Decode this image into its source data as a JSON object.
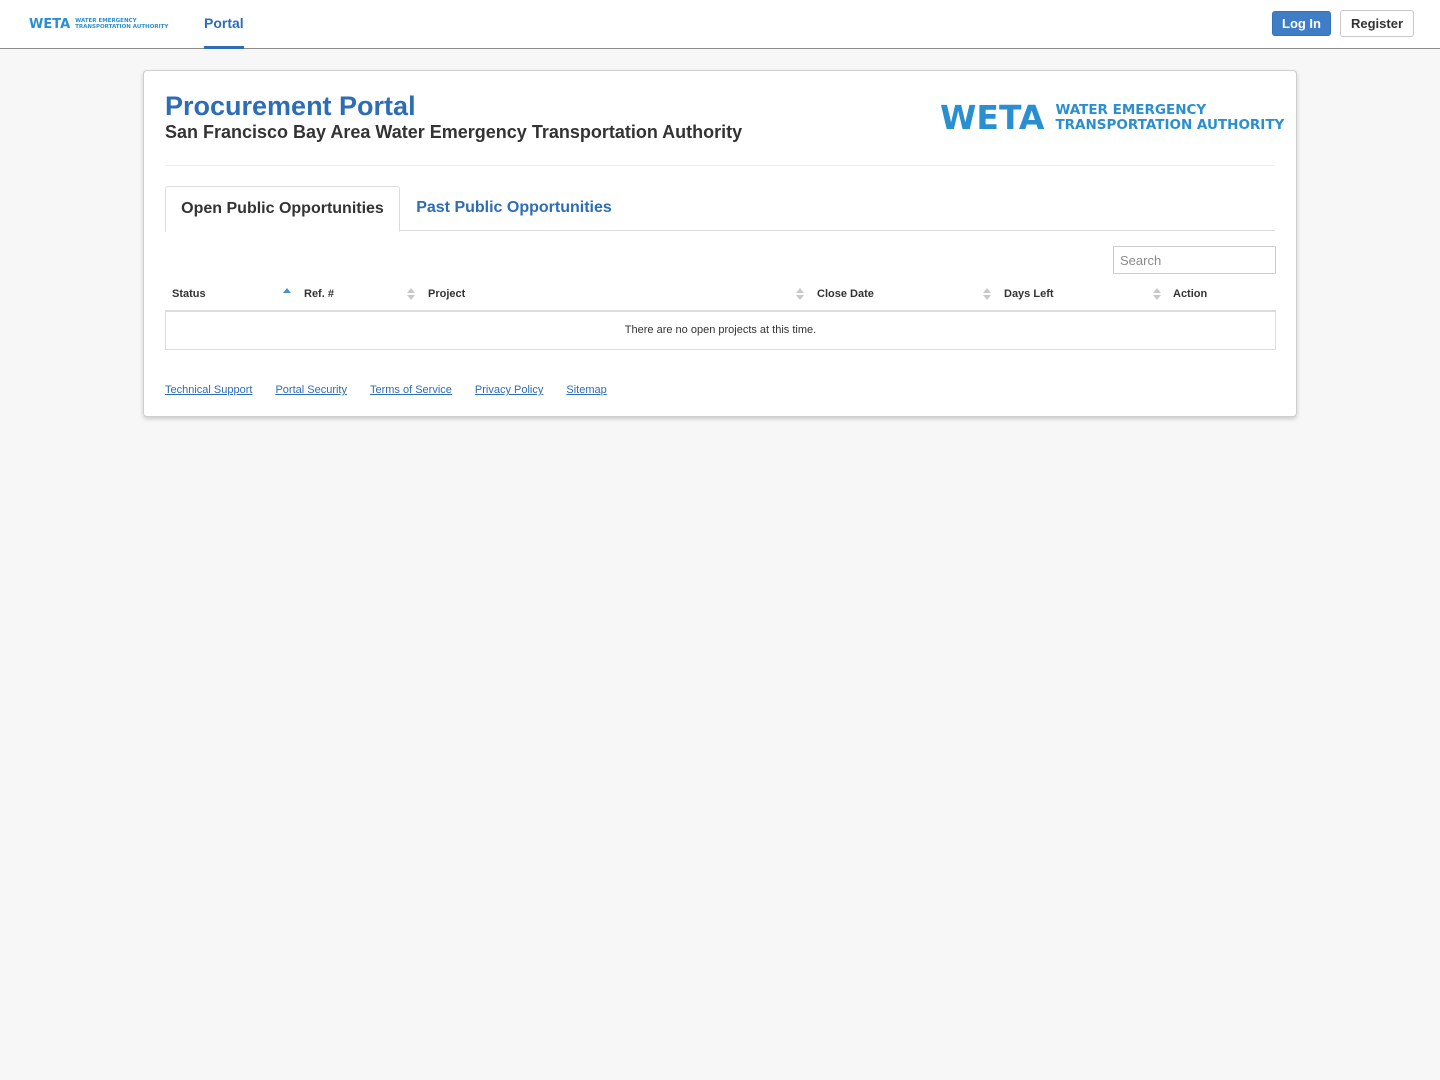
{
  "topnav": {
    "logo": {
      "mark": "WETA",
      "line1": "Water Emergency",
      "line2": "Transportation Authority"
    },
    "portal_tab": "Portal",
    "login_label": "Log In",
    "register_label": "Register"
  },
  "header": {
    "title": "Procurement Portal",
    "subtitle": "San Francisco Bay Area Water Emergency Transportation Authority",
    "logo": {
      "mark": "WETA",
      "line1": "Water Emergency",
      "line2": "Transportation Authority"
    }
  },
  "tabs": [
    {
      "label": "Open Public Opportunities",
      "active": true
    },
    {
      "label": "Past Public Opportunities",
      "active": false
    }
  ],
  "search": {
    "placeholder": "Search",
    "value": ""
  },
  "table": {
    "columns": [
      {
        "label": "Status",
        "sort": "ascending"
      },
      {
        "label": "Ref. #",
        "sort": "none"
      },
      {
        "label": "Project",
        "sort": "none"
      },
      {
        "label": "Close Date",
        "sort": "none"
      },
      {
        "label": "Days Left",
        "sort": "none"
      },
      {
        "label": "Action",
        "sort": "none"
      }
    ],
    "rows": [],
    "empty_message": "There are no open projects at this time."
  },
  "footer": {
    "links": [
      "Technical Support",
      "Portal Security",
      "Terms of Service",
      "Privacy Policy",
      "Sitemap"
    ]
  },
  "colors": {
    "brand_blue": "#2d6db5",
    "logo_blue": "#2a8fd0",
    "login_button": "#3f7ec6",
    "page_background": "#f7f7f7"
  }
}
